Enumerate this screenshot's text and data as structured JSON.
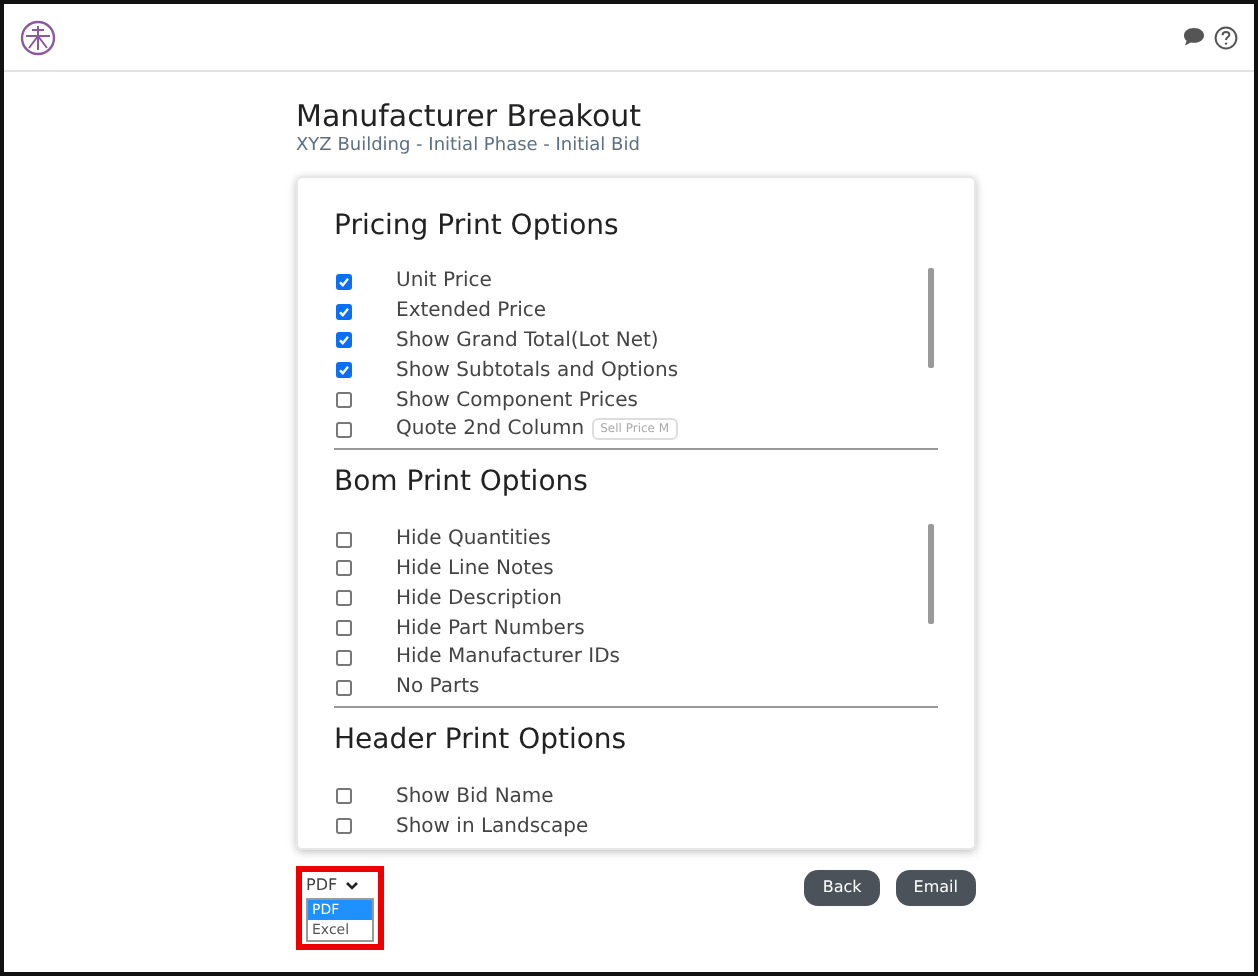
{
  "page": {
    "title": "Manufacturer Breakout",
    "subtitle": "XYZ Building - Initial Phase - Initial Bid"
  },
  "sections": [
    {
      "title": "Pricing Print Options",
      "scrollbar": true,
      "options": [
        {
          "label": "Unit Price",
          "checked": true
        },
        {
          "label": "Extended Price",
          "checked": true
        },
        {
          "label": "Show Grand Total(Lot Net)",
          "checked": true
        },
        {
          "label": "Show Subtotals and Options",
          "checked": true
        },
        {
          "label": "Show Component Prices",
          "checked": false
        },
        {
          "label": "Quote 2nd Column",
          "checked": false,
          "select": "Sell Price M"
        }
      ]
    },
    {
      "title": "Bom Print Options",
      "scrollbar": true,
      "options": [
        {
          "label": "Hide Quantities",
          "checked": false
        },
        {
          "label": "Hide Line Notes",
          "checked": false
        },
        {
          "label": "Hide Description",
          "checked": false
        },
        {
          "label": "Hide Part Numbers",
          "checked": false
        },
        {
          "label": "Hide Manufacturer IDs",
          "checked": false
        },
        {
          "label": "No Parts",
          "checked": false
        }
      ]
    },
    {
      "title": "Header Print Options",
      "scrollbar": false,
      "options": [
        {
          "label": "Show Bid Name",
          "checked": false
        },
        {
          "label": "Show in Landscape",
          "checked": false
        }
      ]
    }
  ],
  "format_select": {
    "value": "PDF",
    "expanded": true,
    "options": [
      {
        "label": "PDF",
        "selected": true
      },
      {
        "label": "Excel",
        "selected": false
      }
    ]
  },
  "buttons": [
    "Back",
    "Email"
  ]
}
